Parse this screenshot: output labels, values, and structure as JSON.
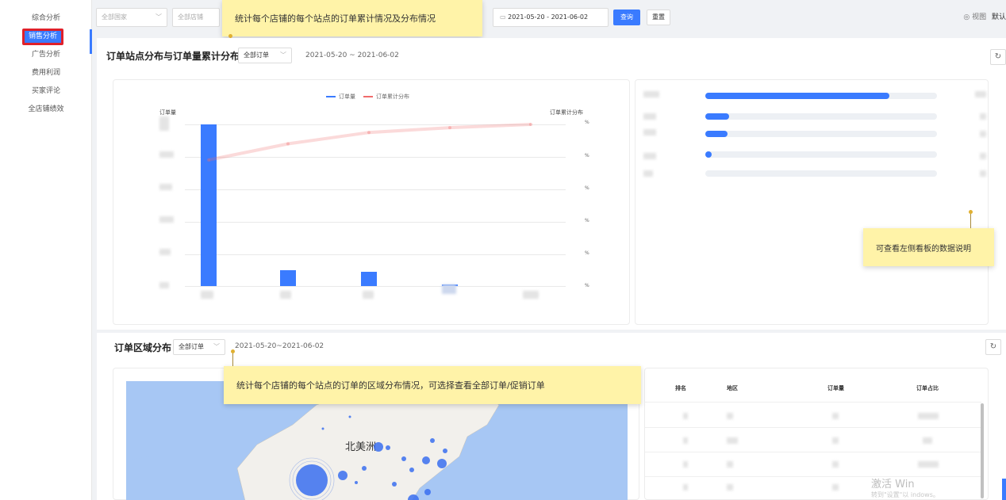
{
  "sidebar": {
    "items": [
      {
        "label": "综合分析"
      },
      {
        "label": "销售分析"
      },
      {
        "label": "广告分析"
      },
      {
        "label": "费用利润"
      },
      {
        "label": "买家评论"
      },
      {
        "label": "全店铺绩效"
      }
    ],
    "active_index": 1
  },
  "filters": {
    "country_placeholder": "全部国家",
    "shop_placeholder": "全部店铺",
    "date_range": "2021-05-20  -  2021-06-02",
    "search_label": "查询",
    "reset_label": "重置",
    "view_label": "视图",
    "default_label": "默认"
  },
  "tooltips": {
    "top": "统计每个店铺的每个站点的订单累计情况及分布情况",
    "right": "可查看左侧看板的数据说明",
    "middle": "统计每个店铺的每个站点的订单的区域分布情况，可选择查看全部订单/促销订单"
  },
  "order_site_section": {
    "title": "订单站点分布与订单量累计分布",
    "filter_label": "全部订单",
    "date_text": "2021-05-20 ~ 2021-06-02",
    "refresh_icon": "refresh-icon"
  },
  "order_region_section": {
    "title": "订单区域分布",
    "filter_label": "全部订单",
    "date_text": "2021-05-20~2021-06-02"
  },
  "chart_data": {
    "type": "bar",
    "legend": [
      "订单量",
      "订单累计分布"
    ],
    "ylabel": "订单量",
    "y2label": "订单累计分布",
    "series": [
      {
        "name": "订单量",
        "values": [
          100,
          10,
          9,
          1,
          0
        ]
      },
      {
        "name": "订单累计分布",
        "values": [
          78,
          88,
          95,
          98,
          100
        ]
      }
    ],
    "y2_tick_suffix": [
      "%",
      "%",
      "%",
      "%",
      "%",
      "%"
    ],
    "colors": {
      "bar": "#3a7bff",
      "line": "#f06b6b"
    }
  },
  "region_table": {
    "headers": [
      "排名",
      "地区",
      "订单量",
      "订单占比"
    ]
  },
  "map": {
    "label": "北美洲"
  },
  "watermark": {
    "line1": "激活 Win",
    "line2": "转到\"设置\"以            indows。"
  }
}
